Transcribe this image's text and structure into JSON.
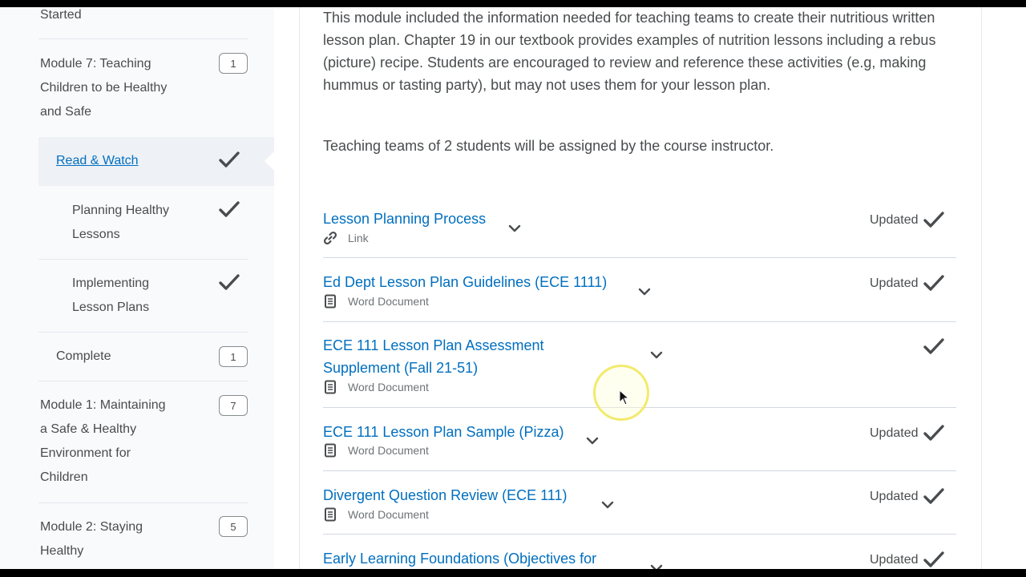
{
  "sidebar": {
    "items": [
      {
        "label": "Started"
      },
      {
        "label_lines": [
          "Module 7: Teaching",
          "Children to be Healthy",
          "and Safe"
        ],
        "badge": "1"
      },
      {
        "label": "Read & Watch",
        "checked": true,
        "selected": true
      },
      {
        "label_lines": [
          "Planning Healthy",
          "Lessons"
        ],
        "checked": true
      },
      {
        "label_lines": [
          "Implementing",
          "Lesson Plans"
        ],
        "checked": true
      },
      {
        "label": "Complete",
        "badge": "1"
      },
      {
        "label_lines": [
          "Module 1: Maintaining",
          "a Safe & Healthy",
          "Environment for",
          "Children"
        ],
        "badge": "7"
      },
      {
        "label_lines": [
          "Module 2: Staying",
          "Healthy"
        ],
        "badge": "5"
      }
    ]
  },
  "main": {
    "intro": "This module included the information needed for teaching teams to create their nutritious written lesson plan.  Chapter 19 in our textbook provides examples of nutrition lessons including a rebus (picture) recipe.  Students are encouraged to review and reference these activities (e.g, making hummus or tasting party), but may not uses them for your lesson plan.",
    "teams": "Teaching teams of 2 students will be assigned by the course instructor.",
    "rows": [
      {
        "title_lines": [
          "Lesson Planning Process"
        ],
        "type": "Link",
        "icon": "link-icon",
        "status": "Updated"
      },
      {
        "title_lines": [
          "Ed Dept Lesson Plan Guidelines (ECE 1111)"
        ],
        "type": "Word Document",
        "icon": "document-icon",
        "status": "Updated"
      },
      {
        "title_lines": [
          "ECE 111 Lesson Plan Assessment",
          "Supplement (Fall 21-51)"
        ],
        "type": "Word Document",
        "icon": "document-icon",
        "status": ""
      },
      {
        "title_lines": [
          "ECE 111 Lesson Plan Sample (Pizza)"
        ],
        "type": "Word Document",
        "icon": "document-icon",
        "status": "Updated"
      },
      {
        "title_lines": [
          "Divergent Question Review (ECE 111)"
        ],
        "type": "Word Document",
        "icon": "document-icon",
        "status": "Updated"
      },
      {
        "title_lines": [
          "Early Learning Foundations (Objectives for"
        ],
        "type": "",
        "icon": "",
        "status": "Updated"
      }
    ]
  },
  "colors": {
    "link": "#006fbf",
    "text": "#494c4e",
    "sidebar_bg": "#f9fafb",
    "selected_bg": "#eef1f5",
    "cursor_highlight": "#f2ea6d"
  }
}
